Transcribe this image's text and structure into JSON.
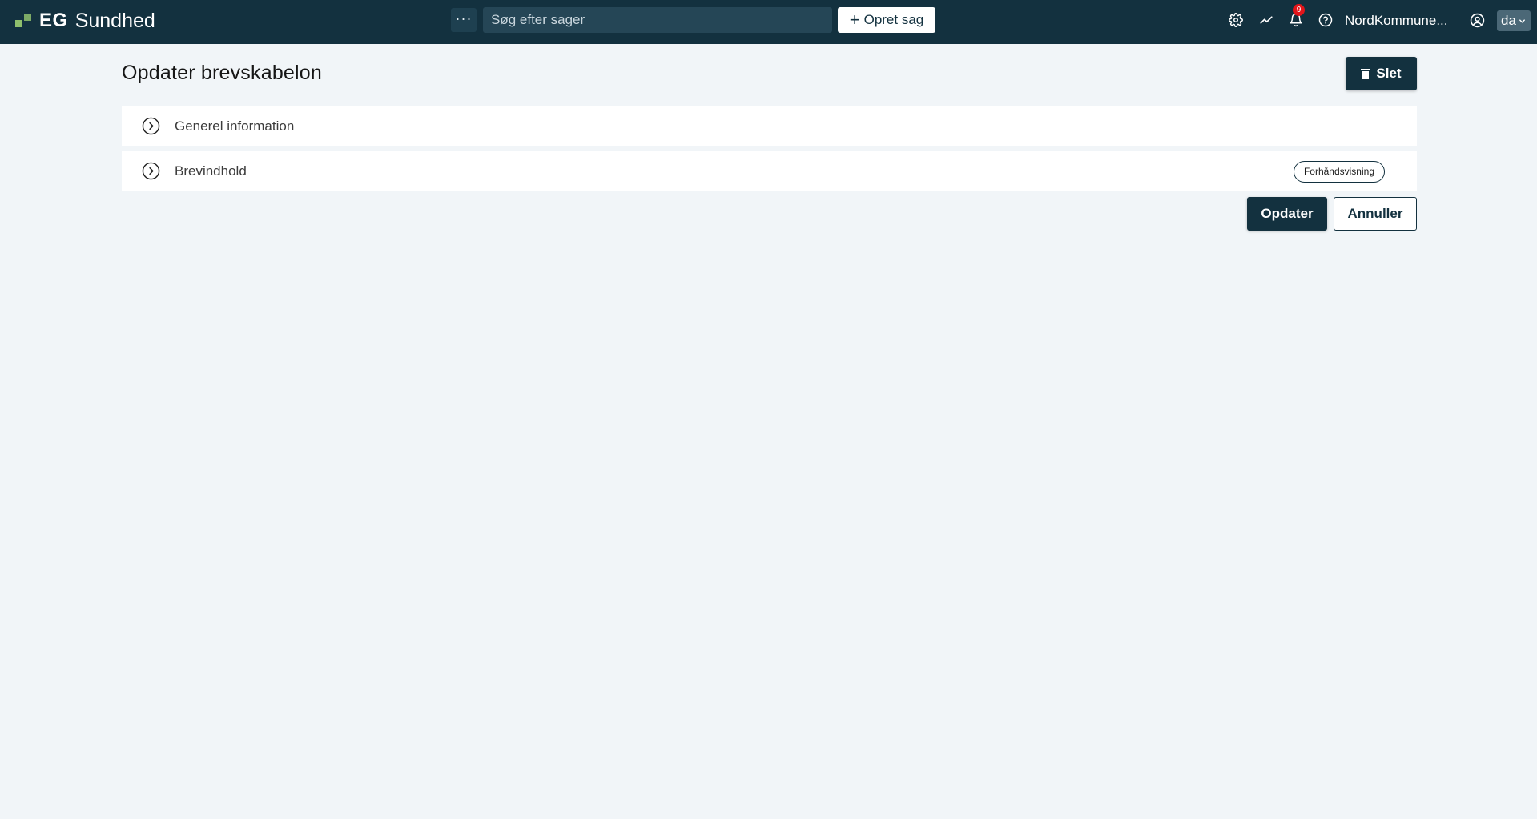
{
  "header": {
    "brand_short": "EG",
    "brand_name": "Sundhed",
    "more_label": "···",
    "search_placeholder": "Søg efter sager",
    "create_label": "Opret sag",
    "notification_count": "9",
    "organization": "NordKommune...",
    "language": "da",
    "icons": [
      "settings-icon",
      "trend-icon",
      "bell-icon",
      "help-icon",
      "user-icon",
      "chevron-down-icon"
    ]
  },
  "page": {
    "title": "Opdater brevskabelon",
    "delete_label": "Slet",
    "sections": [
      {
        "label": "Generel information"
      },
      {
        "label": "Brevindhold",
        "action": "Forhåndsvisning"
      }
    ],
    "update_label": "Opdater",
    "cancel_label": "Annuller"
  },
  "colors": {
    "header_bg": "#13313f",
    "page_bg": "#f1f5f8",
    "brand_accent": "#8fbf6d",
    "badge": "#e3151a"
  }
}
